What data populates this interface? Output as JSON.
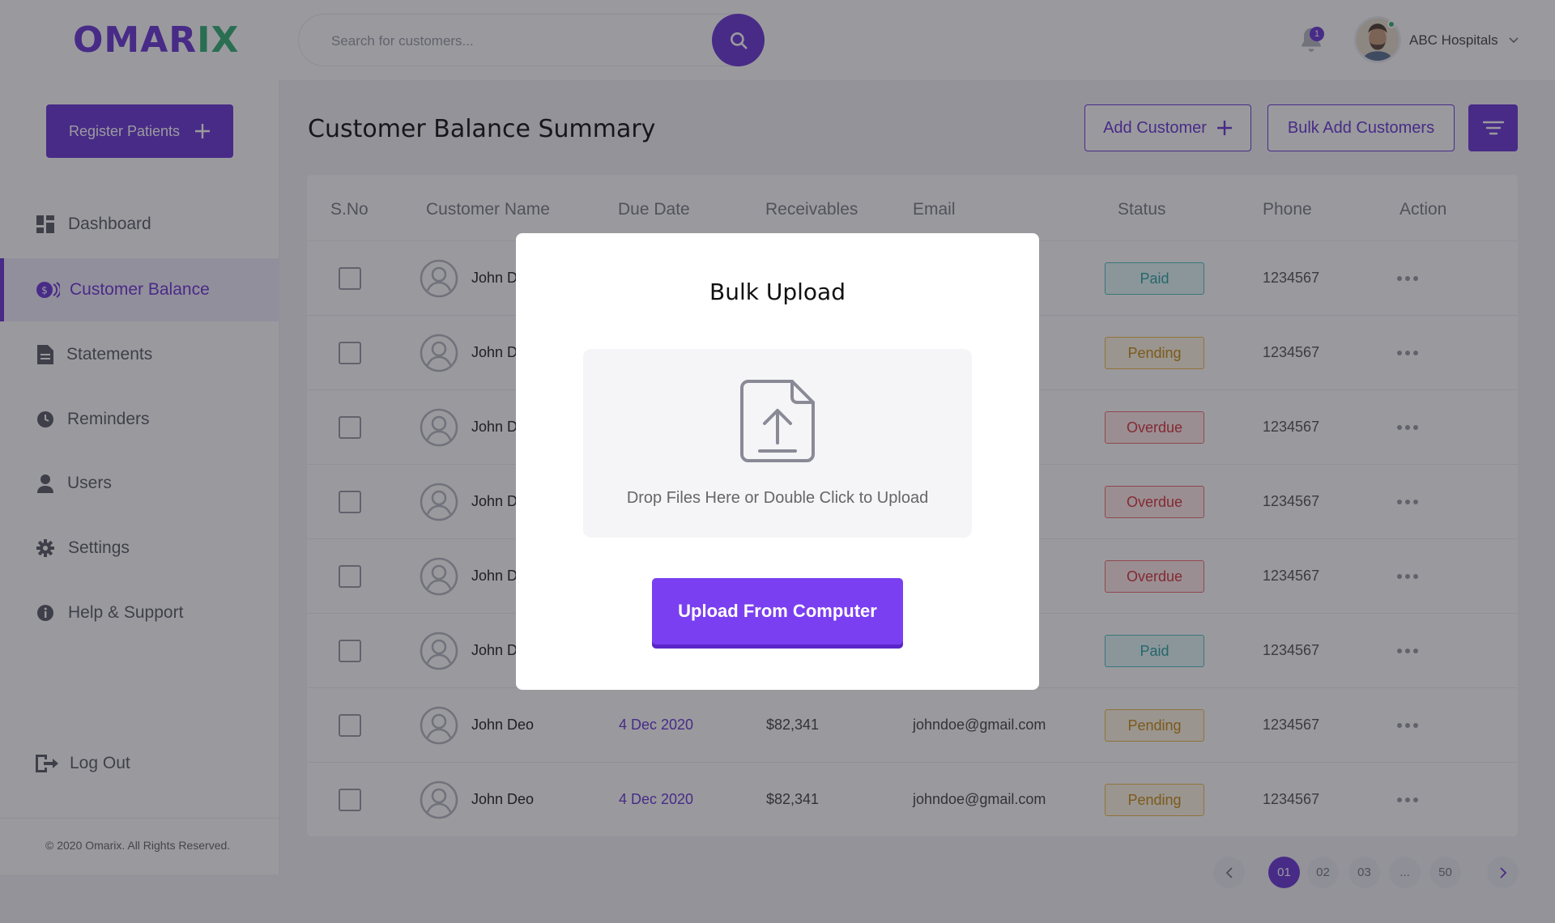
{
  "brand": {
    "logo_part1": "OMAR",
    "logo_part2": "IX"
  },
  "search": {
    "placeholder": "Search for customers..."
  },
  "notifications": {
    "count": "1"
  },
  "user": {
    "name": "ABC Hospitals"
  },
  "sidebar": {
    "register_label": "Register Patients",
    "items": [
      {
        "label": "Dashboard",
        "icon": "dashboard-icon",
        "active": false
      },
      {
        "label": "Customer Balance",
        "icon": "coin-icon",
        "active": true
      },
      {
        "label": "Statements",
        "icon": "document-icon",
        "active": false
      },
      {
        "label": "Reminders",
        "icon": "clock-icon",
        "active": false
      },
      {
        "label": "Users",
        "icon": "user-icon",
        "active": false
      },
      {
        "label": "Settings",
        "icon": "gear-icon",
        "active": false
      },
      {
        "label": "Help & Support",
        "icon": "info-icon",
        "active": false
      }
    ],
    "logout_label": "Log Out",
    "copyright": "© 2020 Omarix. All Rights Reserved."
  },
  "main": {
    "title": "Customer Balance Summary",
    "add_customer_label": "Add Customer",
    "bulk_add_label": "Bulk Add Customers"
  },
  "table": {
    "columns": [
      "S.No",
      "Customer Name",
      "Due Date",
      "Receivables",
      "Email",
      "Status",
      "Phone",
      "Action"
    ],
    "rows": [
      {
        "name": "John D",
        "due": "",
        "receivable": "",
        "email": "m",
        "status": "Paid",
        "phone": "1234567"
      },
      {
        "name": "John D",
        "due": "",
        "receivable": "",
        "email": "m",
        "status": "Pending",
        "phone": "1234567"
      },
      {
        "name": "John D",
        "due": "",
        "receivable": "",
        "email": "m",
        "status": "Overdue",
        "phone": "1234567"
      },
      {
        "name": "John D",
        "due": "",
        "receivable": "",
        "email": "m",
        "status": "Overdue",
        "phone": "1234567"
      },
      {
        "name": "John D",
        "due": "",
        "receivable": "",
        "email": "m",
        "status": "Overdue",
        "phone": "1234567"
      },
      {
        "name": "John D",
        "due": "",
        "receivable": "",
        "email": "m",
        "status": "Paid",
        "phone": "1234567"
      },
      {
        "name": "John Deo",
        "due": "4 Dec 2020",
        "receivable": "$82,341",
        "email": "johndoe@gmail.com",
        "status": "Pending",
        "phone": "1234567"
      },
      {
        "name": "John Deo",
        "due": "4 Dec 2020",
        "receivable": "$82,341",
        "email": "johndoe@gmail.com",
        "status": "Pending",
        "phone": "1234567"
      }
    ]
  },
  "pagination": {
    "pages": [
      "01",
      "02",
      "03",
      "...",
      "50"
    ],
    "current": "01"
  },
  "modal": {
    "title": "Bulk Upload",
    "dropzone_text": "Drop Files Here or Double Click to Upload",
    "upload_button": "Upload From Computer"
  },
  "colors": {
    "accent": "#6b35d6",
    "brand_green": "#33b075",
    "paid": "#2aa3a3",
    "pending": "#c98a10",
    "overdue": "#d8323c"
  }
}
